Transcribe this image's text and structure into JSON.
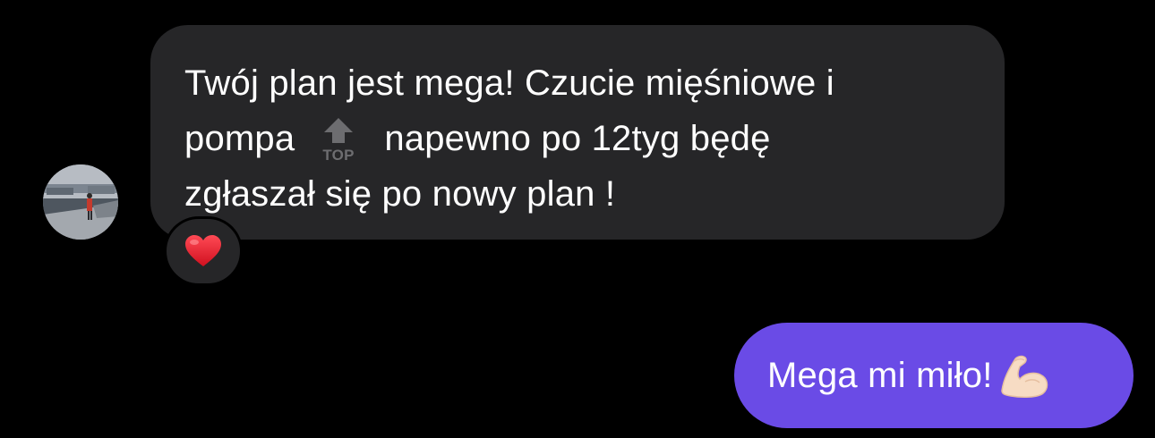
{
  "messages": {
    "incoming": {
      "line1": "Twój plan jest mega! Czucie mięśniowe i",
      "line2_before": "pompa",
      "line2_emoji": "top-arrow-emoji",
      "line2_after": "napewno po 12tyg będę",
      "line3": "zgłaszał się po nowy plan !",
      "reaction": "heart-emoji"
    },
    "outgoing": {
      "text": "Mega mi miło!",
      "emoji": "flexed-biceps-emoji"
    }
  },
  "top_emoji_label": "TOP",
  "colors": {
    "background": "#000000",
    "incoming_bubble": "#262628",
    "outgoing_bubble": "#6a4be6",
    "text": "#ffffff",
    "heart": "#e8192c"
  }
}
